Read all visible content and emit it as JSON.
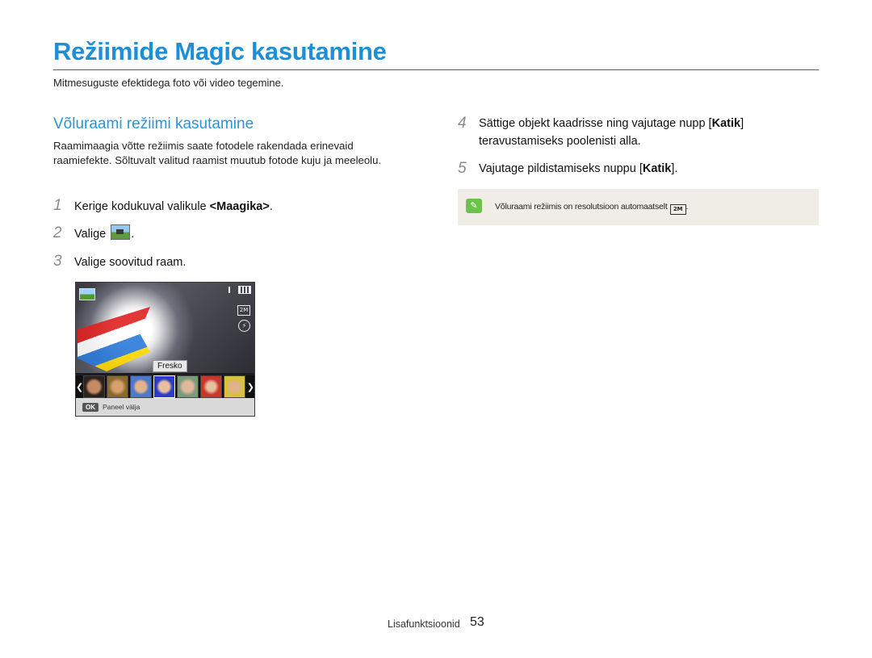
{
  "page": {
    "title": "Režiimide Magic kasutamine",
    "subtitle": "Mitmesuguste efektidega foto või video tegemine.",
    "section_title": "Võluraami režiimi kasutamine",
    "intro": "Raamimaagia võtte režiimis saate fotodele rakendada erinevaid raamiefekte. Sõltuvalt valitud raamist muutub fotode kuju ja meeleolu."
  },
  "steps_left": [
    {
      "num": "1",
      "pre": "Kerige kodukuval valikule ",
      "bold": "<Maagika>",
      "post": "."
    },
    {
      "num": "2",
      "pre": "Valige",
      "post": ".",
      "icon": "magic-frame-icon"
    },
    {
      "num": "3",
      "pre": "Valige soovitud raam."
    }
  ],
  "camera_screen": {
    "frame_label": "Fresko",
    "bottom_key": "OK",
    "bottom_label": "Paneel välja",
    "res_icon_text": "2M",
    "flash_icon_text": "⚡",
    "left_arrow": "❮",
    "right_arrow": "❯",
    "icons": [
      "mode-icon",
      "signal-icon",
      "battery-icon",
      "resolution-icon",
      "flash-icon"
    ]
  },
  "steps_right": [
    {
      "num": "4",
      "pre": "Sättige objekt kaadrisse ning vajutage nupp [",
      "bold": "Katik",
      "post": "] teravustamiseks poolenisti alla."
    },
    {
      "num": "5",
      "pre": "Vajutage pildistamiseks nuppu [",
      "bold": "Katik",
      "post": "]."
    }
  ],
  "note": {
    "icon": "note-icon",
    "icon_glyph": "✎",
    "text": "Võluraami režiimis on resolutsioon automaatselt",
    "res_icon_text": "2M",
    "post": "."
  },
  "footer": {
    "section": "Lisafunktsioonid",
    "page_number": "53"
  },
  "colors": {
    "title": "#1e8fd6",
    "section_title": "#2a95d8",
    "note_bg": "#efede6",
    "step_number": "#8a8a8a"
  }
}
